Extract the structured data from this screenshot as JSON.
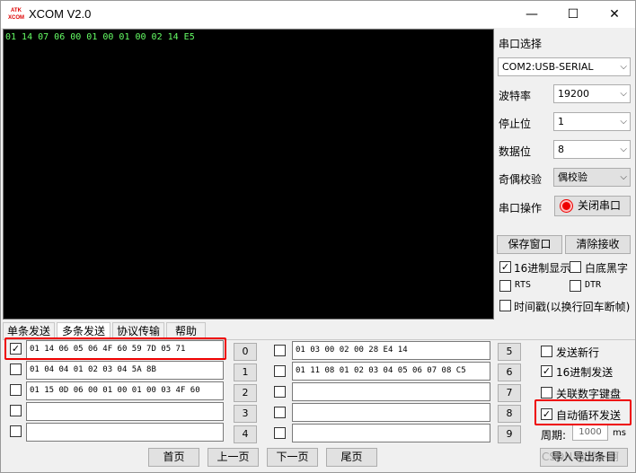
{
  "window": {
    "icon_text_top": "ATK",
    "icon_text_bottom": "XCOM",
    "title": "XCOM V2.0",
    "minimize": "—",
    "maximize": "☐",
    "close": "✕"
  },
  "receive": {
    "text": "01 14 07 06 00 01 00 01 00 02 14 E5"
  },
  "settings": {
    "port_select_label": "串口选择",
    "port_value": "COM2:USB-SERIAL",
    "baud_label": "波特率",
    "baud_value": "19200",
    "stopbit_label": "停止位",
    "stopbit_value": "1",
    "databit_label": "数据位",
    "databit_value": "8",
    "parity_label": "奇偶校验",
    "parity_value": "偶校验",
    "port_op_label": "串口操作",
    "port_op_button": "关闭串口",
    "save_window": "保存窗口",
    "clear_receive": "清除接收",
    "hex_display": "16进制显示",
    "white_bg": "白底黑字",
    "rts": "RTS",
    "dtr": "DTR",
    "timestamp": "时间戳(以换行回车断帧)"
  },
  "tabs": [
    "单条发送",
    "多条发送",
    "协议传输",
    "帮助"
  ],
  "multi_send": {
    "left_rows": [
      {
        "checked": true,
        "value": "01 14 06 05 06 4F 60 59 7D 05 71",
        "num": "0"
      },
      {
        "checked": false,
        "value": "01 04 04 01 02 03 04 5A 8B",
        "num": "1"
      },
      {
        "checked": false,
        "value": "01 15 0D 06 00 01 00 01 00 03 4F 60",
        "num": "2"
      },
      {
        "checked": false,
        "value": "",
        "num": "3"
      },
      {
        "checked": false,
        "value": "",
        "num": "4"
      }
    ],
    "right_rows": [
      {
        "checked": false,
        "value": "01 03 00 02 00 28 E4 14",
        "num": "5"
      },
      {
        "checked": false,
        "value": "01 11 08 01 02 03 04 05 06 07 08 C5",
        "num": "6"
      },
      {
        "checked": false,
        "value": "",
        "num": "7"
      },
      {
        "checked": false,
        "value": "",
        "num": "8"
      },
      {
        "checked": false,
        "value": "",
        "num": "9"
      }
    ],
    "send_newline": "发送新行",
    "hex_send": "16进制发送",
    "link_keypad": "关联数字键盘",
    "auto_loop": "自动循环发送",
    "period_label": "周期:",
    "period_value": "1000",
    "period_unit": "ms",
    "first_page": "首页",
    "prev_page": "上一页",
    "next_page": "下一页",
    "last_page": "尾页",
    "import_export": "导入导出条目"
  },
  "watermark": "CSDN @萝卜啊",
  "check_mark": "✓",
  "arrow": "⌵",
  "colors": {
    "receive_bg": "#000000",
    "receive_text": "#66ff66",
    "highlight": "#ee0000"
  }
}
